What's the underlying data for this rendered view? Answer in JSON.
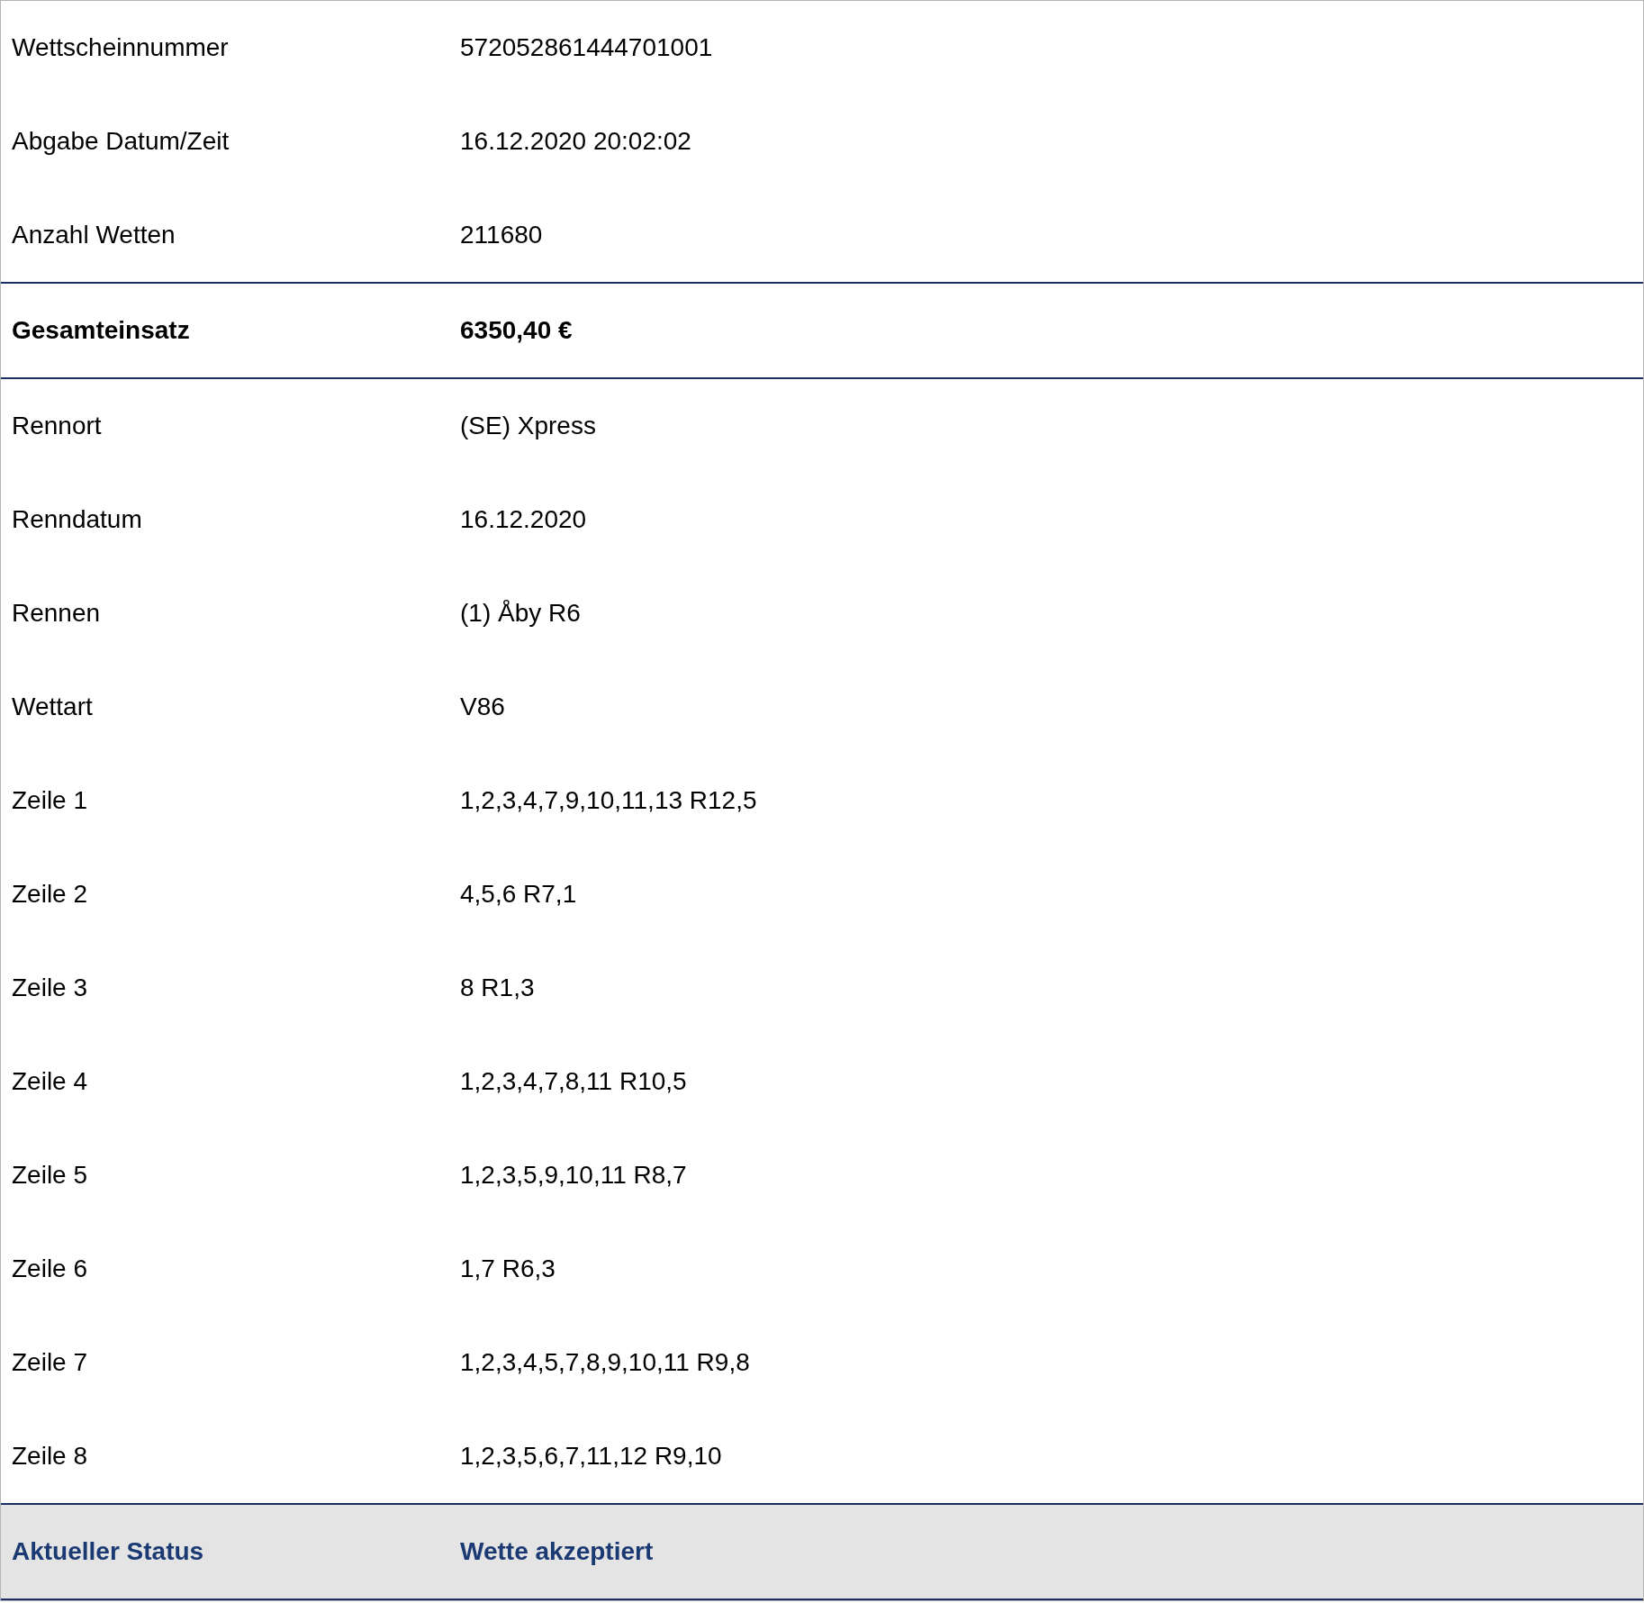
{
  "rows": [
    {
      "kind": "normal",
      "label": "Wettscheinnummer",
      "value": "572052861444701001"
    },
    {
      "kind": "normal",
      "label": "Abgabe Datum/Zeit",
      "value": "16.12.2020 20:02:02"
    },
    {
      "kind": "normal",
      "label": "Anzahl Wetten",
      "value": "211680"
    },
    {
      "kind": "total",
      "label": "Gesamteinsatz",
      "value": "6350,40 €"
    },
    {
      "kind": "normal",
      "label": "Rennort",
      "value": "(SE) Xpress"
    },
    {
      "kind": "normal",
      "label": "Renndatum",
      "value": "16.12.2020"
    },
    {
      "kind": "normal",
      "label": "Rennen",
      "value": "(1) Åby R6"
    },
    {
      "kind": "normal",
      "label": "Wettart",
      "value": "V86"
    },
    {
      "kind": "normal",
      "label": "Zeile 1",
      "value": "1,2,3,4,7,9,10,11,13 R12,5"
    },
    {
      "kind": "normal",
      "label": "Zeile 2",
      "value": "4,5,6 R7,1"
    },
    {
      "kind": "normal",
      "label": "Zeile 3",
      "value": "8 R1,3"
    },
    {
      "kind": "normal",
      "label": "Zeile 4",
      "value": "1,2,3,4,7,8,11 R10,5"
    },
    {
      "kind": "normal",
      "label": "Zeile 5",
      "value": "1,2,3,5,9,10,11 R8,7"
    },
    {
      "kind": "normal",
      "label": "Zeile 6",
      "value": "1,7 R6,3"
    },
    {
      "kind": "normal",
      "label": "Zeile 7",
      "value": "1,2,3,4,5,7,8,9,10,11 R9,8"
    },
    {
      "kind": "normal",
      "label": "Zeile 8",
      "value": "1,2,3,5,6,7,11,12 R9,10"
    },
    {
      "kind": "status",
      "label": "Aktueller Status",
      "value": "Wette akzeptiert"
    }
  ]
}
